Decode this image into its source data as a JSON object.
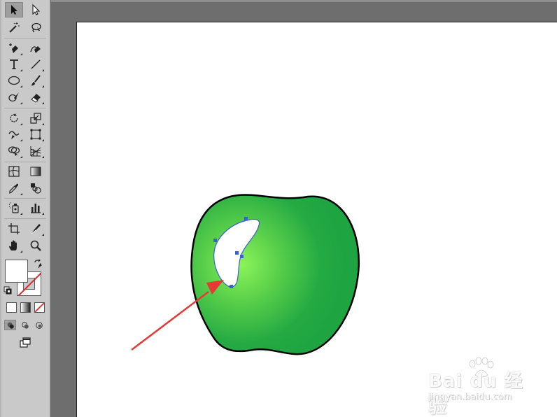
{
  "toolbar": {
    "tools": [
      {
        "name": "selection-tool",
        "icon": "selection-arrow-icon",
        "active": true
      },
      {
        "name": "direct-selection-tool",
        "icon": "direct-selection-arrow-icon"
      },
      {
        "name": "magic-wand-tool",
        "icon": "magic-wand-icon"
      },
      {
        "name": "lasso-tool",
        "icon": "lasso-icon"
      },
      {
        "name": "pen-tool",
        "icon": "pen-icon"
      },
      {
        "name": "curvature-tool",
        "icon": "curvature-pen-icon"
      },
      {
        "name": "type-tool",
        "icon": "type-icon",
        "glyph": "T"
      },
      {
        "name": "line-segment-tool",
        "icon": "line-segment-icon"
      },
      {
        "name": "ellipse-tool",
        "icon": "ellipse-icon"
      },
      {
        "name": "paintbrush-tool",
        "icon": "paintbrush-icon"
      },
      {
        "name": "shaper-tool",
        "icon": "shaper-icon"
      },
      {
        "name": "eraser-tool",
        "icon": "eraser-icon"
      },
      {
        "name": "rotate-tool",
        "icon": "rotate-icon"
      },
      {
        "name": "scale-tool",
        "icon": "scale-icon"
      },
      {
        "name": "warp-tool",
        "icon": "warp-icon"
      },
      {
        "name": "free-transform-tool",
        "icon": "free-transform-icon"
      },
      {
        "name": "shape-builder-tool",
        "icon": "shape-builder-icon"
      },
      {
        "name": "perspective-grid-tool",
        "icon": "perspective-grid-icon"
      },
      {
        "name": "mesh-tool",
        "icon": "mesh-icon"
      },
      {
        "name": "gradient-tool",
        "icon": "gradient-icon"
      },
      {
        "name": "eyedropper-tool",
        "icon": "eyedropper-icon"
      },
      {
        "name": "blend-tool",
        "icon": "blend-icon"
      },
      {
        "name": "symbol-sprayer-tool",
        "icon": "symbol-sprayer-icon"
      },
      {
        "name": "column-graph-tool",
        "icon": "column-graph-icon"
      },
      {
        "name": "artboard-tool",
        "icon": "artboard-icon"
      },
      {
        "name": "slice-tool",
        "icon": "slice-icon"
      },
      {
        "name": "hand-tool",
        "icon": "hand-icon"
      },
      {
        "name": "zoom-tool",
        "icon": "zoom-icon"
      }
    ],
    "fill_color": "#ffffff",
    "stroke_color": "none",
    "draw_modes": [
      "draw-normal",
      "draw-behind",
      "draw-inside"
    ],
    "color_modes": [
      "color",
      "gradient",
      "none"
    ]
  },
  "canvas": {
    "artboard_color": "#ffffff",
    "pasteboard_color": "#6e6e6e",
    "apple": {
      "fill_gradient_center": "#8cf45a",
      "fill_gradient_edge": "#1ea441",
      "outline_color": "#000000"
    },
    "highlight_shape": {
      "fill": "#ffffff",
      "selection_color": "#3b5fd6"
    },
    "arrow_color": "#e53935"
  },
  "watermark": {
    "logo": "Bai du 经验",
    "subtext": "jingyan.baidu.com"
  }
}
